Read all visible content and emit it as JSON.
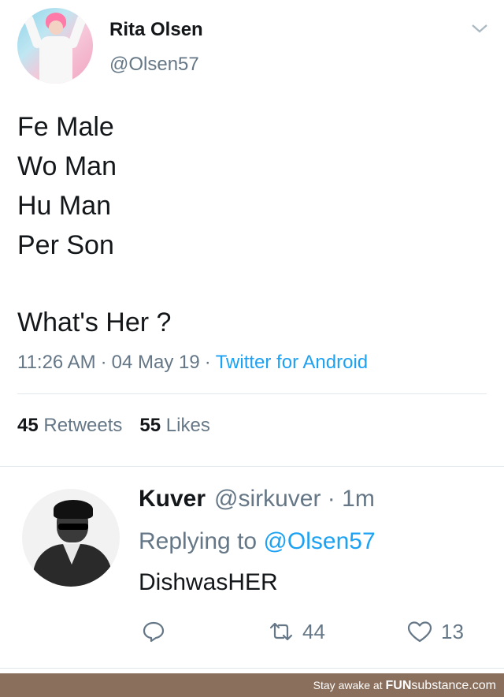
{
  "tweet": {
    "author_name": "Rita Olsen",
    "author_handle": "@Olsen57",
    "lines": [
      "Fe Male",
      "Wo Man",
      "Hu Man",
      "Per Son"
    ],
    "question": "What's Her ?",
    "time": "11:26 AM",
    "date": "04 May 19",
    "client": "Twitter for Android",
    "retweets_count": "45",
    "retweets_label": "Retweets",
    "likes_count": "55",
    "likes_label": "Likes"
  },
  "reply": {
    "author_name": "Kuver",
    "author_handle": "@sirkuver · 1m",
    "replying_prefix": "Replying to",
    "replying_mention": "@Olsen57",
    "text": "DishwasHER",
    "retweet_count": "44",
    "like_count": "13"
  },
  "footer": {
    "text": "Stay awake at",
    "brand_bold": "FUN",
    "brand_rest": "substance.com"
  },
  "colors": {
    "link_blue": "#1da1f2",
    "secondary_gray": "#657786",
    "footer_brown": "#8a6f5c"
  }
}
